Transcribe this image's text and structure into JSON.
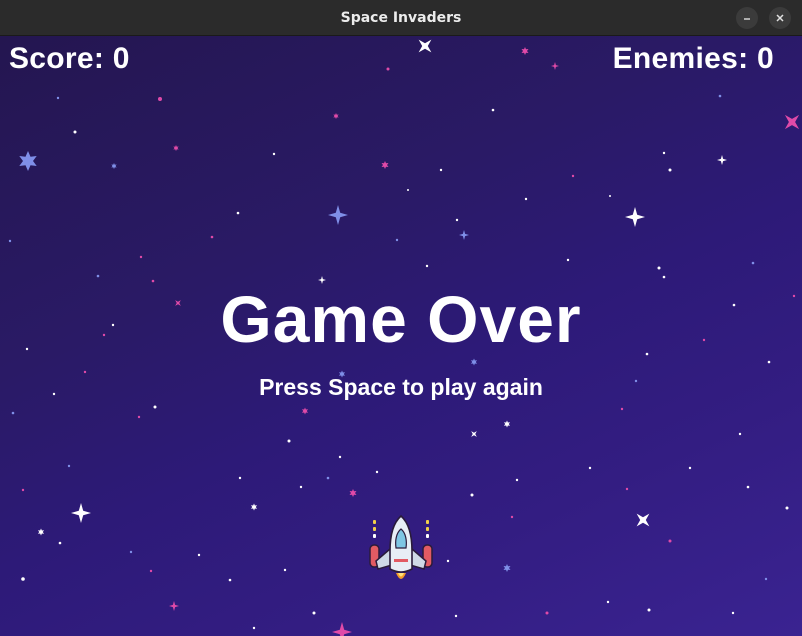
{
  "window": {
    "title": "Space Invaders",
    "controls": {
      "minimize_icon": "minimize-icon",
      "close_icon": "close-icon"
    }
  },
  "hud": {
    "score_text": "Score: 0",
    "enemies_text": "Enemies: 0"
  },
  "overlay": {
    "game_over_text": "Game Over",
    "prompt_text": "Press Space to play again"
  },
  "player": {
    "icon": "spaceship-icon"
  },
  "colors": {
    "background_top": "#241650",
    "background_bottom": "#3a2391",
    "text": "#ffffff",
    "star_white": "#ffffff",
    "star_pink": "#e04aa8",
    "star_blue": "#7f8fe8"
  }
}
